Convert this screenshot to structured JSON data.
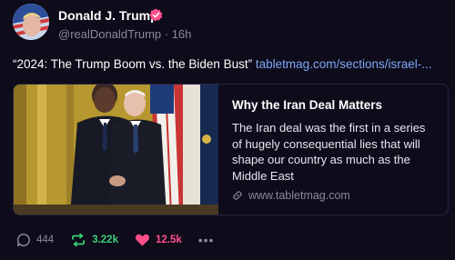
{
  "author": {
    "name": "Donald J. Trump",
    "handle": "@realDonaldTrump",
    "time": "16h",
    "handle_line": "@realDonaldTrump · 16h"
  },
  "post": {
    "text": "“2024: The Trump Boom vs. the Biden Bust”",
    "link": "tabletmag.com/sections/israel-..."
  },
  "card": {
    "title": "Why the Iran Deal Matters",
    "description": "The Iran deal was the first in a series of hugely consequential lies that will shape our country as much as the Middle East",
    "domain": "www.tabletmag.com"
  },
  "actions": {
    "replies": "444",
    "reposts": "3.22k",
    "likes": "12.5k",
    "more": "•••"
  },
  "colors": {
    "background": "#0e0b1a",
    "link": "#7fa8f5",
    "verified": "#ff4f8a",
    "repost": "#3ad07a",
    "like": "#ff4f8a",
    "muted": "#8b8a9a"
  }
}
